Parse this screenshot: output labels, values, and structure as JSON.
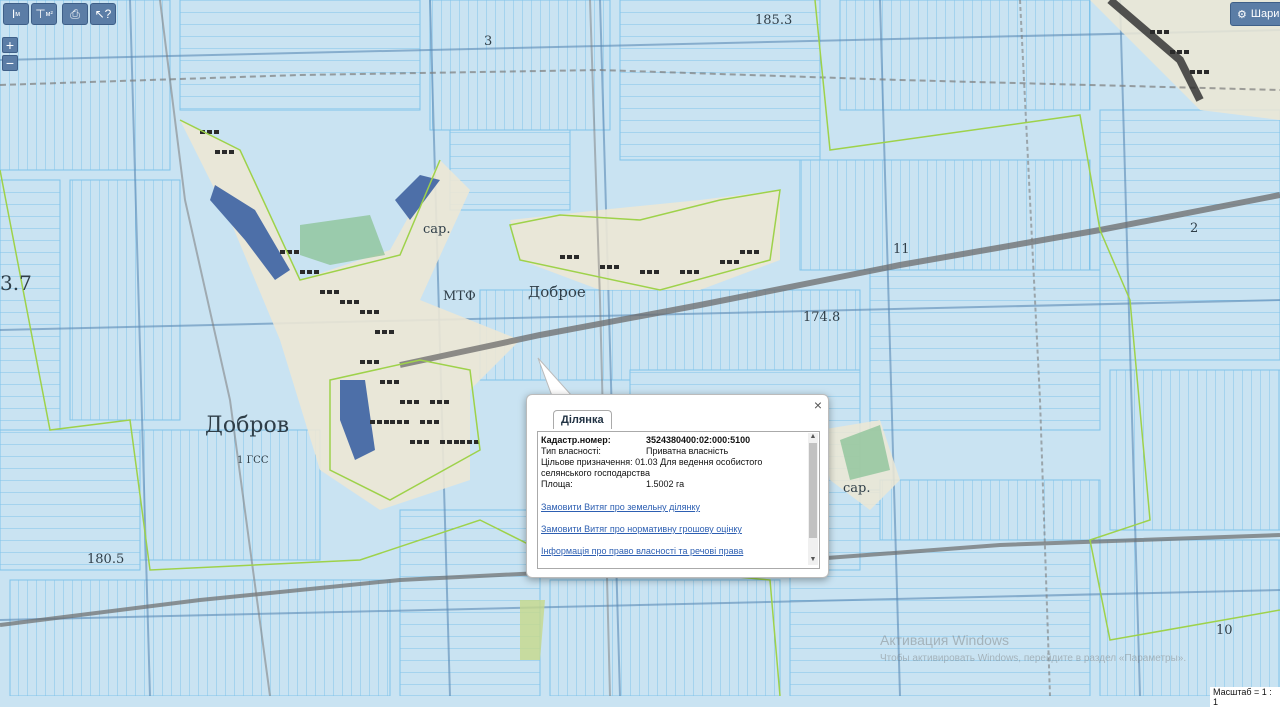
{
  "toolbar": {
    "buttons": [
      {
        "name": "measure-length-button",
        "glyph": "I",
        "sub": "м"
      },
      {
        "name": "measure-area-button",
        "glyph": "⊤",
        "sub": "м²"
      },
      {
        "name": "print-button",
        "glyph": "⎙"
      },
      {
        "name": "identify-button",
        "glyph": "↖?"
      }
    ]
  },
  "zoom": {
    "in": "+",
    "out": "−"
  },
  "layers_label": "Шари",
  "map_labels": [
    {
      "text": "Добров",
      "size": 22
    },
    {
      "text": "Доброе",
      "size": 15
    },
    {
      "text": "МТФ",
      "size": 13
    },
    {
      "text": "174.8",
      "size": 13
    },
    {
      "text": "180.5",
      "size": 13
    },
    {
      "text": "185.3",
      "size": 13
    },
    {
      "text": "сар.",
      "size": 13
    },
    {
      "text": "сар.",
      "size": 13
    },
    {
      "text": "3.7",
      "size": 20
    },
    {
      "text": "11",
      "size": 13
    },
    {
      "text": "2",
      "size": 13
    },
    {
      "text": "3",
      "size": 13
    },
    {
      "text": "10",
      "size": 13
    },
    {
      "text": "1 ГСС",
      "size": 10
    }
  ],
  "popup": {
    "tab": "Ділянка",
    "close": "×",
    "fields": {
      "cadastral_label": "Кадастр.номер:",
      "cadastral_value": "3524380400:02:000:5100",
      "ownership_label": "Тип власності:",
      "ownership_value": "Приватна власність",
      "purpose_label": "Цільове призначення:",
      "purpose_value": "01.03 Для ведення особистого селянського господарства",
      "area_label": "Площа:",
      "area_value": "1.5002 га"
    },
    "links": [
      "Замовити Витяг про земельну ділянку",
      "Замовити Витяг про нормативну грошову оцінку",
      "Інформація про право власності та речові права"
    ]
  },
  "watermark": {
    "title": "Активация Windows",
    "subtitle": "Чтобы активировать Windows, перейдите в раздел «Параметры»."
  },
  "scale_label": "Масштаб = 1 : 1",
  "colors": {
    "parcel_fill": "#c7e2f3",
    "parcel_line": "#7fc3ea",
    "boundary": "#9ed24a",
    "road": "#6b6b6b",
    "settlement": "#2a2a2a"
  }
}
